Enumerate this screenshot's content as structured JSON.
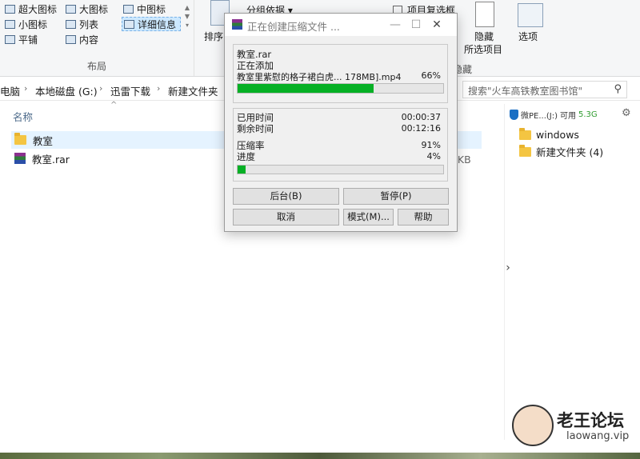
{
  "ribbon": {
    "layout_items": [
      {
        "label": "超大图标"
      },
      {
        "label": "大图标"
      },
      {
        "label": "中图标"
      },
      {
        "label": "小图标"
      },
      {
        "label": "列表"
      },
      {
        "label": "详细信息"
      },
      {
        "label": "平铺"
      },
      {
        "label": "内容"
      }
    ],
    "layout_group_label": "布局",
    "sort_label": "排序",
    "group_by_label": "分组依据",
    "item_checkbox_label": "项目复选框",
    "hide_label": "隐藏",
    "hide_selected_label": "所选项目",
    "hide_section_label": "隐藏",
    "options_label": "选项"
  },
  "address": {
    "crumbs": [
      "电脑",
      "本地磁盘 (G:)",
      "迅雷下载",
      "新建文件夹"
    ],
    "search_placeholder": "搜索\"火车高铁教室图书馆\""
  },
  "files": {
    "column_name": "名称",
    "rows": [
      {
        "name": "教室",
        "type": "folder",
        "selected": true
      },
      {
        "name": "教室.rar",
        "type": "rar",
        "size": "0 KB"
      }
    ]
  },
  "right_panel": {
    "drive_label": "微PE...(J:)",
    "drive_free_prefix": "可用",
    "drive_free": "5.3G",
    "tree": [
      {
        "label": "windows"
      },
      {
        "label": "新建文件夹 (4)"
      }
    ]
  },
  "dialog": {
    "title": "正在创建压缩文件 ...",
    "archive_name": "教室.rar",
    "adding_label": "正在添加",
    "current_file": "教室里紫慰的格子裙白虎... 178MB].mp4",
    "current_percent": "66%",
    "current_progress": 0.66,
    "elapsed_label": "已用时间",
    "elapsed_value": "00:00:37",
    "remaining_label": "剩余时间",
    "remaining_value": "00:12:16",
    "ratio_label": "压缩率",
    "ratio_value": "91%",
    "progress_label": "进度",
    "progress_value": "4%",
    "total_progress": 0.04,
    "buttons": {
      "background": "后台(B)",
      "pause": "暂停(P)",
      "cancel": "取消",
      "mode": "模式(M)...",
      "help": "帮助"
    }
  },
  "watermark": {
    "title": "老王论坛",
    "subtitle": "laowang.vip"
  },
  "colors": {
    "progress_green": "#06b025",
    "selection_blue": "#cce8ff",
    "free_space_green": "#2e9b2e"
  }
}
